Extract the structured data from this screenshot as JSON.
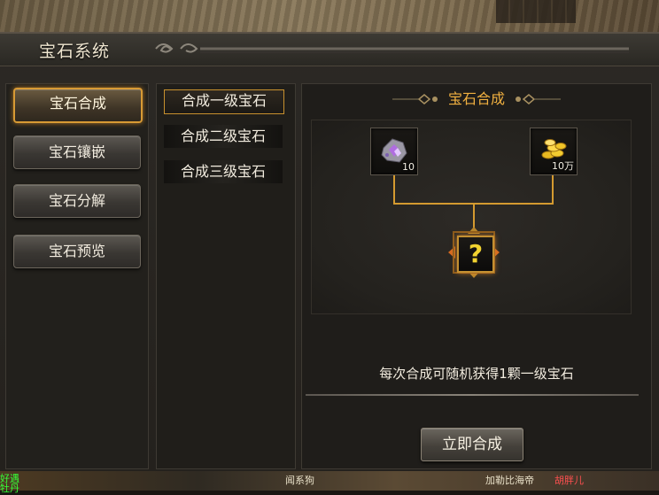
{
  "window": {
    "title": "宝石系统"
  },
  "sidebar": {
    "items": [
      {
        "label": "宝石合成",
        "active": true
      },
      {
        "label": "宝石镶嵌",
        "active": false
      },
      {
        "label": "宝石分解",
        "active": false
      },
      {
        "label": "宝石预览",
        "active": false
      }
    ]
  },
  "levels": {
    "items": [
      {
        "label": "合成一级宝石",
        "active": true
      },
      {
        "label": "合成二级宝石",
        "active": false
      },
      {
        "label": "合成三级宝石",
        "active": false
      }
    ]
  },
  "craft": {
    "title": "宝石合成",
    "materials": [
      {
        "icon": "gem-ore-icon",
        "count": "10"
      },
      {
        "icon": "gold-coins-icon",
        "count": "10万"
      }
    ],
    "result": {
      "icon": "question-mark-icon",
      "symbol": "?"
    },
    "info": "每次合成可随机获得1颗一级宝石",
    "button_label": "立即合成"
  },
  "bottom_bar": {
    "left_text": "好遇",
    "left_text2": "牡丹",
    "center_text": "闻系狗",
    "right_text": "加勒比海帝",
    "right_text_red": "胡胖儿"
  },
  "colors": {
    "accent": "#f0b040",
    "active_border": "#d89a34",
    "text": "#f2ecdf"
  }
}
